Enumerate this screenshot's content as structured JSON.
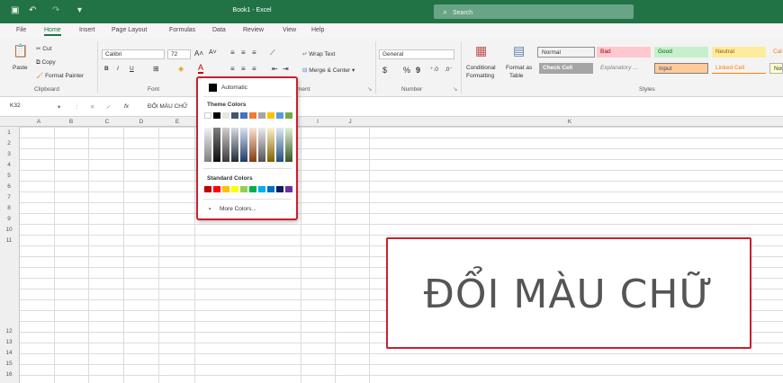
{
  "window": {
    "title": "Book1 - Excel",
    "search_placeholder": "Search"
  },
  "menu": {
    "tabs": [
      "File",
      "Home",
      "Insert",
      "Page Layout",
      "Formulas",
      "Data",
      "Review",
      "View",
      "Help"
    ]
  },
  "ribbon": {
    "clipboard": {
      "paste": "Paste",
      "cut": "Cut",
      "copy": "Copy",
      "format_painter": "Format Painter",
      "group": "Clipboard"
    },
    "font": {
      "name": "Calibri",
      "size": "72",
      "bold": "B",
      "italic": "I",
      "underline": "U",
      "group": "Font"
    },
    "alignment": {
      "wrap_text": "Wrap Text",
      "merge_center": "Merge & Center",
      "group_suffix": "ment"
    },
    "number": {
      "format": "General",
      "currency": "$",
      "percent": "%",
      "comma": "9",
      "group": "Number"
    },
    "styles": {
      "conditional": "Conditional",
      "formatting": "Formatting",
      "format_as": "Format as",
      "table": "Table",
      "cells": [
        {
          "label": "Normal",
          "bg": "#ffffff",
          "fg": "#000000"
        },
        {
          "label": "Bad",
          "bg": "#ffc7ce",
          "fg": "#9c0006"
        },
        {
          "label": "Good",
          "bg": "#c6efce",
          "fg": "#006100"
        },
        {
          "label": "Neutral",
          "bg": "#ffeb9c",
          "fg": "#9c5700"
        },
        {
          "label": "Cal",
          "bg": "#f2f2f2",
          "fg": "#fa7d00"
        },
        {
          "label": "Check Cell",
          "bg": "#a5a5a5",
          "fg": "#ffffff"
        },
        {
          "label": "Explanatory ...",
          "bg": "#ffffff",
          "fg": "#7f7f7f"
        },
        {
          "label": "Input",
          "bg": "#ffcc99",
          "fg": "#3f3f76"
        },
        {
          "label": "Linked Cell",
          "bg": "#ffffff",
          "fg": "#fa7d00"
        },
        {
          "label": "Not",
          "bg": "#ffffcc",
          "fg": "#000000"
        }
      ],
      "group": "Styles"
    }
  },
  "formula_bar": {
    "name_box": "K32",
    "fx": "fx",
    "content": "ĐỔI MÀU CHỮ"
  },
  "grid": {
    "columns": [
      "A",
      "B",
      "C",
      "D",
      "E",
      "I",
      "J",
      "K"
    ],
    "rows": [
      "1",
      "2",
      "3",
      "4",
      "5",
      "6",
      "7",
      "8",
      "9",
      "10",
      "11",
      "12",
      "13",
      "14",
      "15",
      "16"
    ]
  },
  "color_menu": {
    "automatic": "Automatic",
    "theme_title": "Theme Colors",
    "theme_top": [
      "#ffffff",
      "#000000",
      "#e7e6e6",
      "#44546a",
      "#4472c4",
      "#ed7d31",
      "#a5a5a5",
      "#ffc000",
      "#5b9bd5",
      "#70ad47"
    ],
    "standard_title": "Standard Colors",
    "standard": [
      "#c00000",
      "#ff0000",
      "#ffc000",
      "#ffff00",
      "#92d050",
      "#00b050",
      "#00b0f0",
      "#0070c0",
      "#002060",
      "#7030a0"
    ],
    "more": "More Colors..."
  },
  "callout": {
    "text": "ĐỔI MÀU CHỮ"
  }
}
